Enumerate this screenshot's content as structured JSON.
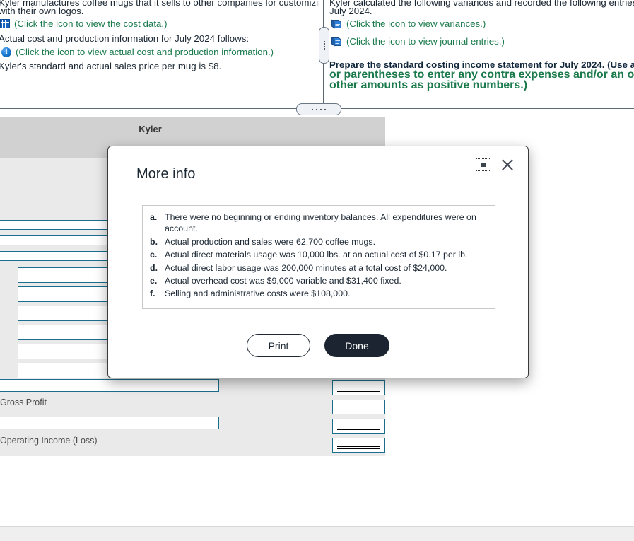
{
  "problem": {
    "left_panel": {
      "intro_line1": "Kyler manufactures coffee mugs that it sells to other companies for customizing",
      "intro_line2": "with their own logos.",
      "cost_data_link": "(Click the icon to view the cost data.)",
      "cost_data_icon": "table-grid-icon",
      "actual_info_line": "Actual cost and production information for July 2024 follows:",
      "actual_info_link": "(Click the icon to view actual cost and production information.)",
      "actual_info_icon": "info-circle-icon",
      "price_line": "Kyler's standard and actual sales price per mug is $8."
    },
    "right_panel": {
      "intro_line1": "Kyler calculated the following variances and recorded the following entries for",
      "intro_line2": "July 2024.",
      "variances_link": "(Click the icon to view variances.)",
      "variances_icon": "book-icon",
      "journal_link": "(Click the icon to view journal entries.)",
      "journal_icon": "book-icon",
      "requirement_line1": "Prepare the standard costing income statement for July 2024. (Use a minus sign",
      "requirement_line2": "or parentheses to enter any contra expenses and/or an operating loss. Enter all",
      "requirement_line3": "other amounts as positive numbers.)"
    }
  },
  "splitters": {
    "vertical_grip": "vertical-splitter-handle",
    "horizontal_grip": "horizontal-splitter-handle"
  },
  "worksheet": {
    "company_title": "Kyler",
    "labels": {
      "gross_profit": "Gross Profit",
      "operating_income": "Operating Income (Loss)"
    }
  },
  "modal": {
    "title": "More info",
    "minimize_icon": "minimize-icon",
    "close_icon": "close-icon",
    "items": [
      {
        "marker": "a.",
        "text": "There were no beginning or ending inventory balances. All expenditures were on account."
      },
      {
        "marker": "b.",
        "text": "Actual production and sales were 62,700 coffee mugs."
      },
      {
        "marker": "c.",
        "text": "Actual direct materials usage was 10,000 lbs. at an actual cost of $0.17 per lb."
      },
      {
        "marker": "d.",
        "text": "Actual direct labor usage was 200,000 minutes at a total cost of $24,000."
      },
      {
        "marker": "e.",
        "text": "Actual overhead cost was $9,000 variable and $31,400 fixed."
      },
      {
        "marker": "f.",
        "text": "Selling and administrative costs were $108,000."
      }
    ],
    "print_label": "Print",
    "done_label": "Done"
  },
  "colors": {
    "link_green": "#1a7a4c",
    "text_dark": "#1b2733",
    "input_border": "#1b6e8c",
    "header_gray": "#d1d1d1",
    "body_gray": "#eaeaea",
    "done_button": "#1b2430"
  }
}
